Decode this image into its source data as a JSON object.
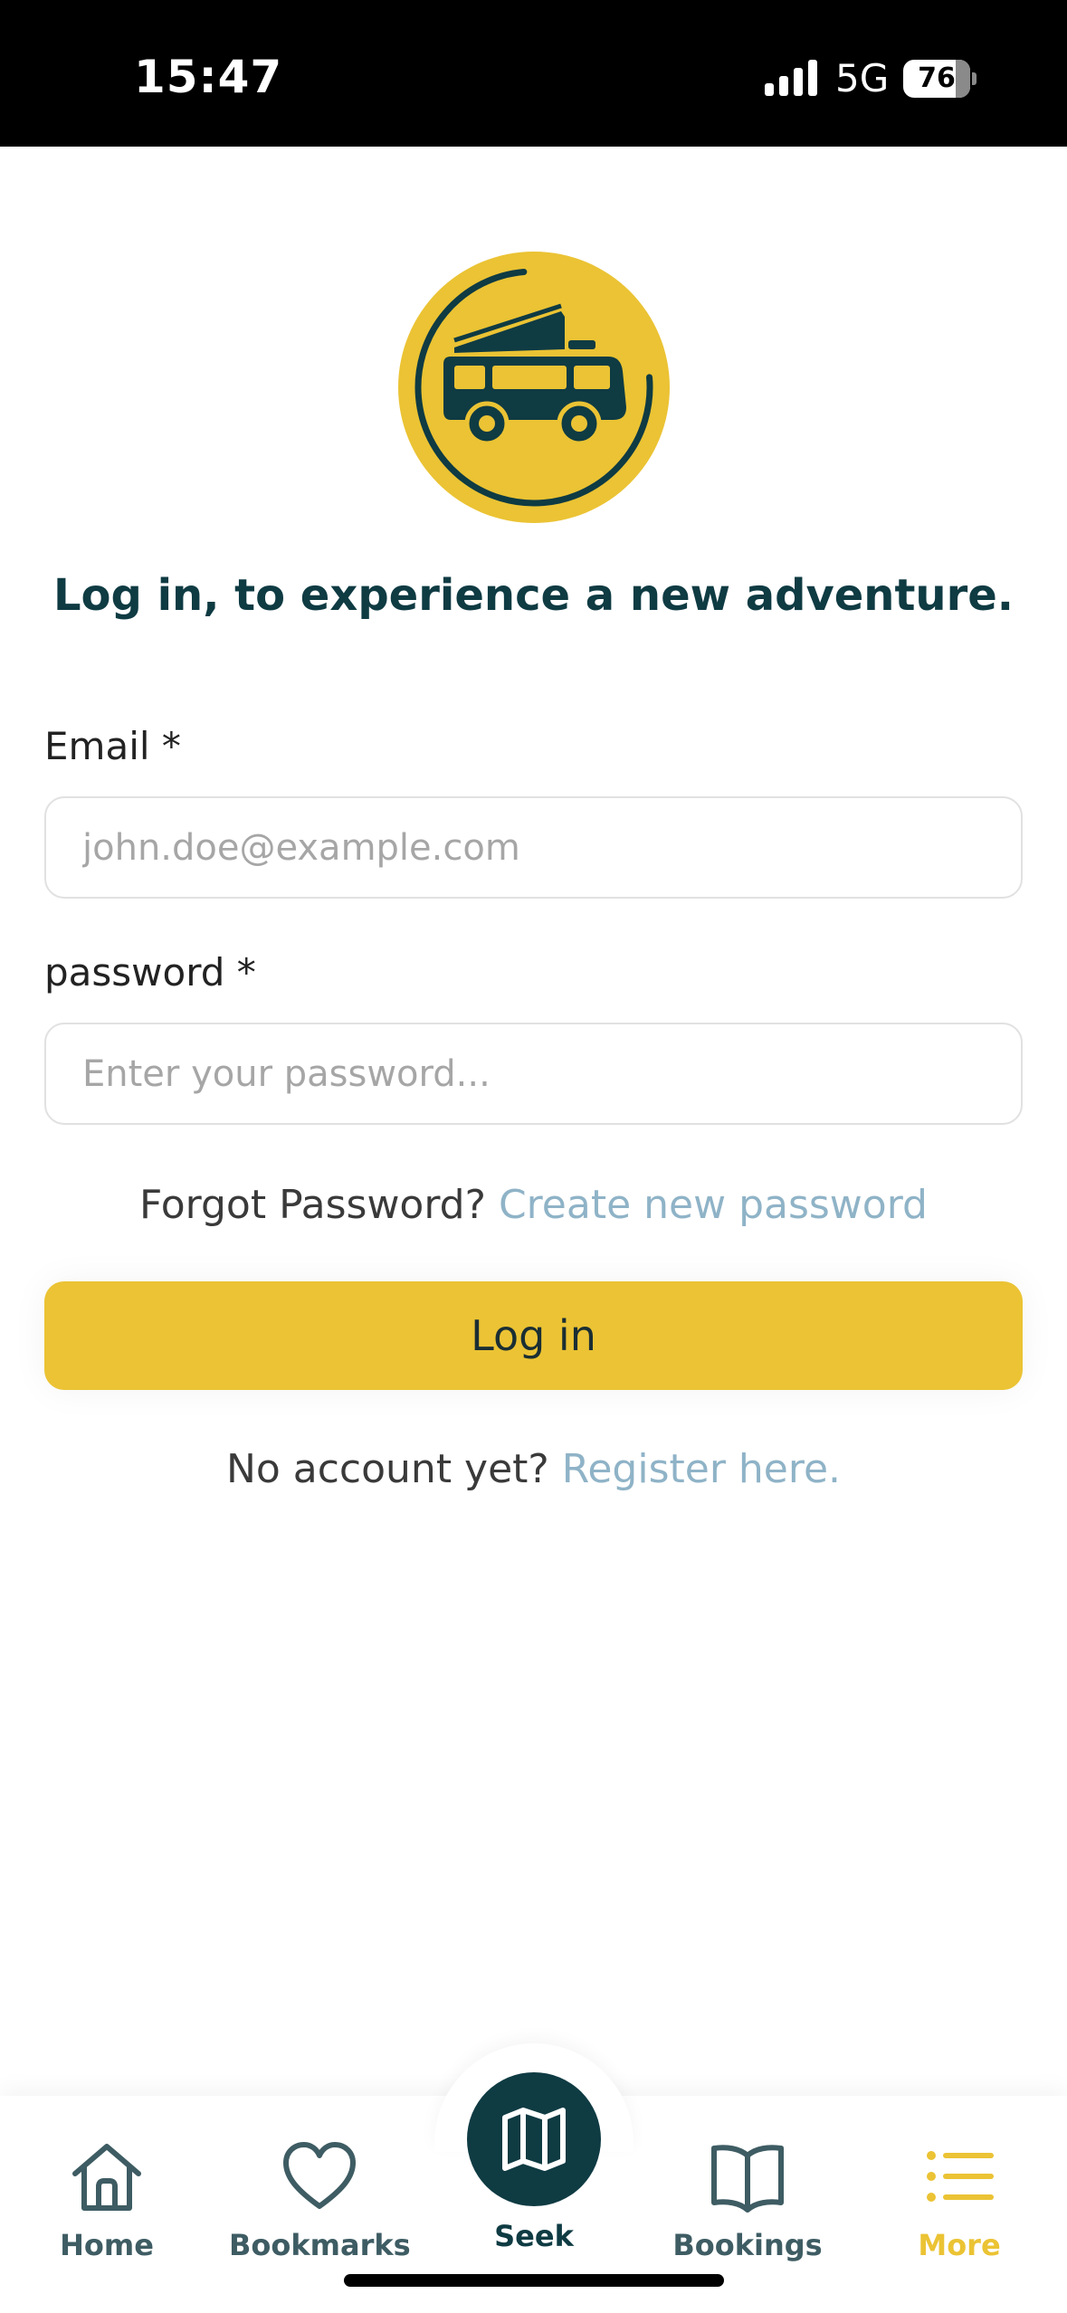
{
  "status_bar": {
    "time": "15:47",
    "network": "5G",
    "battery_level": "76"
  },
  "login": {
    "headline": "Log in, to experience a new adventure.",
    "email": {
      "label": "Email *",
      "value": "",
      "placeholder": "john.doe@example.com"
    },
    "password": {
      "label": "password *",
      "value": "",
      "placeholder": "Enter your password..."
    },
    "forgot": {
      "prefix": "Forgot Password?",
      "link": "Create new password"
    },
    "submit_label": "Log in",
    "register": {
      "prefix": "No account yet?",
      "link": "Register here."
    }
  },
  "tab_bar": {
    "items": [
      {
        "label": "Home",
        "icon": "home-icon"
      },
      {
        "label": "Bookmarks",
        "icon": "heart-icon"
      },
      {
        "label": "Seek",
        "icon": "map-icon"
      },
      {
        "label": "Bookings",
        "icon": "book-icon"
      },
      {
        "label": "More",
        "icon": "menu-list-icon"
      }
    ],
    "active": "More"
  },
  "colors": {
    "brand_yellow": "#EBC334",
    "brand_teal": "#0F3B43",
    "link_blue": "#8FB3C7",
    "tab_inactive": "#3E5C63"
  }
}
